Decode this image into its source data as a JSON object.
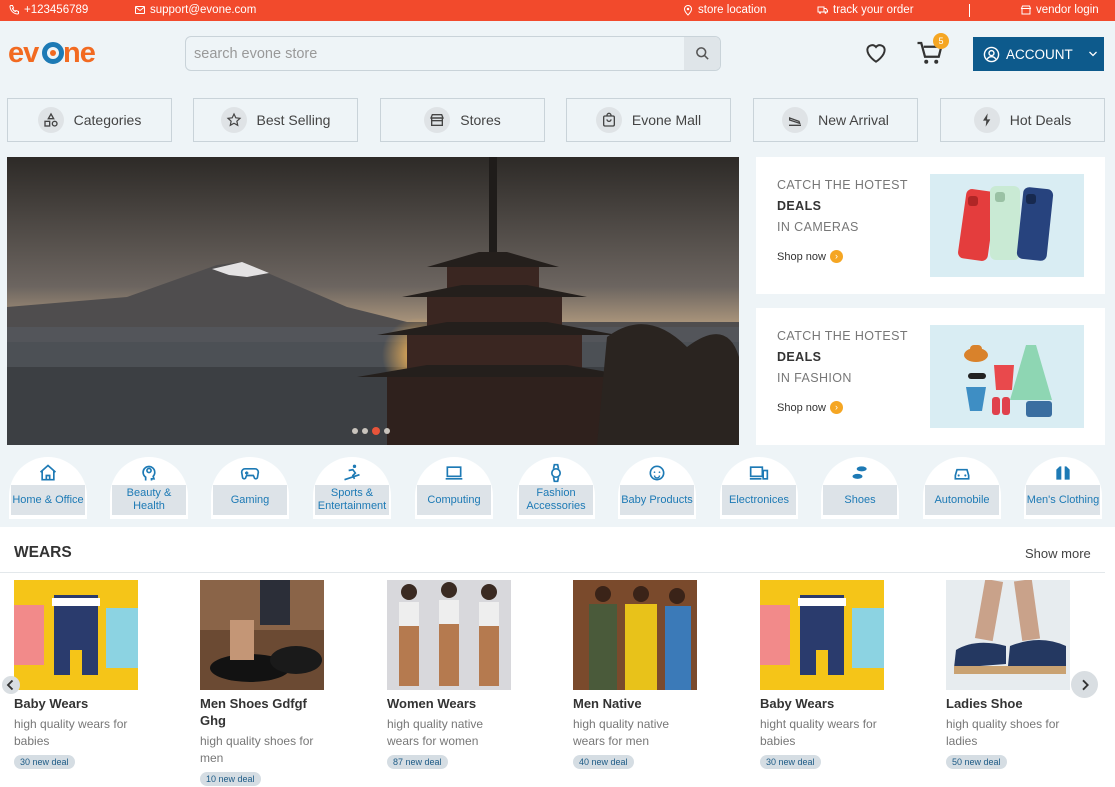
{
  "topbar": {
    "phone": "+123456789",
    "email": "support@evone.com",
    "store_location": "store location",
    "track_order": "track your order",
    "vendor_login": "vendor login"
  },
  "header": {
    "logo": "evone",
    "search_placeholder": "search evone store",
    "cart_count": "5",
    "account_label": "ACCOUNT"
  },
  "categories_nav": [
    {
      "label": "Categories",
      "icon": "shapes-icon"
    },
    {
      "label": "Best Selling",
      "icon": "star-icon"
    },
    {
      "label": "Stores",
      "icon": "store-icon"
    },
    {
      "label": "Evone Mall",
      "icon": "shopping-bag-icon"
    },
    {
      "label": "New Arrival",
      "icon": "plane-landing-icon"
    },
    {
      "label": "Hot Deals",
      "icon": "lightning-icon"
    }
  ],
  "hero": {
    "slides": 4,
    "active_slide": 3
  },
  "promos": [
    {
      "line1": "CATCH THE HOTEST",
      "line2": "DEALS",
      "line3": "IN CAMERAS",
      "cta": "Shop now"
    },
    {
      "line1": "CATCH THE HOTEST",
      "line2": "DEALS",
      "line3": "IN FASHION",
      "cta": "Shop now"
    }
  ],
  "category_icons": [
    {
      "label": "Home & Office",
      "icon": "home-icon"
    },
    {
      "label": "Beauty & Health",
      "icon": "head-icon"
    },
    {
      "label": "Gaming",
      "icon": "gamepad-icon"
    },
    {
      "label": "Sports & Entertainment",
      "icon": "skiing-icon"
    },
    {
      "label": "Computing",
      "icon": "laptop-icon"
    },
    {
      "label": "Fashion Accessories",
      "icon": "watch-icon"
    },
    {
      "label": "Baby Products",
      "icon": "baby-icon"
    },
    {
      "label": "Electronices",
      "icon": "devices-icon"
    },
    {
      "label": "Shoes",
      "icon": "shoe-icon"
    },
    {
      "label": "Automobile",
      "icon": "car-icon"
    },
    {
      "label": "Men's Clothing",
      "icon": "clothing-icon"
    }
  ],
  "wears": {
    "title": "WEARS",
    "show_more": "Show more",
    "products": [
      {
        "name": "Baby Wears",
        "desc": "high quality wears for babies",
        "deal": "30 new deal"
      },
      {
        "name": "Men Shoes Gdfgf Ghg",
        "desc": "high quality shoes for men",
        "deal": "10 new deal"
      },
      {
        "name": "Women Wears",
        "desc": "high quality native wears for women",
        "deal": "87 new deal"
      },
      {
        "name": "Men Native",
        "desc": "high quality native wears for men",
        "deal": "40 new deal"
      },
      {
        "name": "Baby Wears",
        "desc": "hight quality wears for babies",
        "deal": "30 new deal"
      },
      {
        "name": "Ladies Shoe",
        "desc": "high quality shoes for ladies",
        "deal": "50 new deal"
      }
    ]
  },
  "colors": {
    "topbar": "#f24a2c",
    "brand_orange": "#f26a21",
    "brand_blue": "#1d7ab5",
    "account_bg": "#0d5a8c",
    "badge": "#f5a623"
  }
}
